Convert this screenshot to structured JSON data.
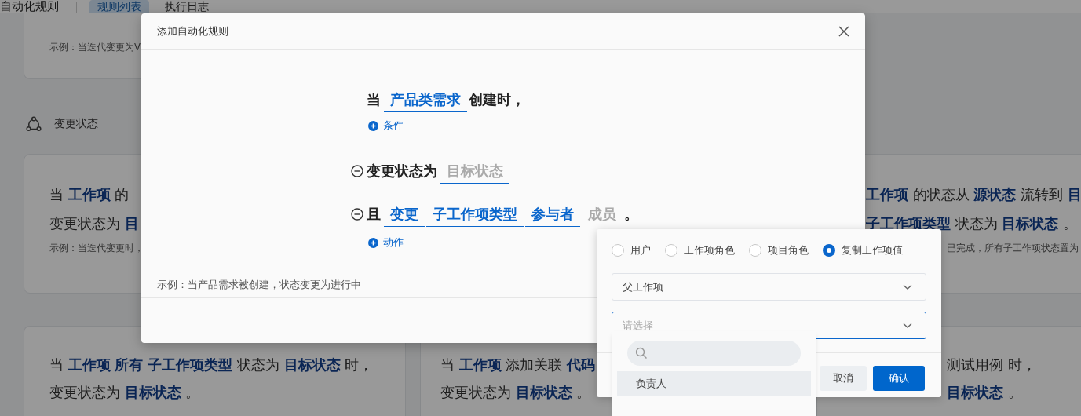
{
  "page": {
    "title": "自动化规则",
    "tabs": [
      {
        "label": "规则列表",
        "selected": true
      },
      {
        "label": "执行日志",
        "selected": false
      }
    ],
    "section": {
      "title": "变更状态"
    },
    "cards": [
      {
        "example": "示例：当迭代变更为V"
      },
      {
        "lines": [
          "当 **工作项** 的",
          "变更状态为 **目**"
        ],
        "example": "示例：当迭代变更时，"
      },
      {
        "lines": [
          "**工作项** 的状态从 **源状态** 流转到 **目**",
          "**子工作项类型** 状态为 **目标状态** 。"
        ],
        "example": "已完成，所有子工作项状态置为"
      },
      {
        "lines": [
          "当 **工作项** **所有** **子工作项类型** 状态为 **目标状态** 时，",
          "变更状态为 **目标状态** 。"
        ]
      },
      {
        "lines": [
          "当 **工作项** 添加关联 **代码**",
          "变更状态为 **目标状态** 。"
        ]
      },
      {
        "lines": [
          "测试用例 时，",
          "**目标状态** 。"
        ]
      }
    ]
  },
  "modal": {
    "title": "添加自动化规则",
    "trigger": [
      {
        "text": "当",
        "kind": "text"
      },
      {
        "text": "产品类需求",
        "kind": "value"
      },
      {
        "text": "创建时，",
        "kind": "text"
      }
    ],
    "add_condition": "条件",
    "actions": [
      [
        {
          "text": "变更状态为",
          "kind": "text"
        },
        {
          "text": "目标状态",
          "kind": "placeholder"
        }
      ],
      [
        {
          "text": "且",
          "kind": "text"
        },
        {
          "text": "变更",
          "kind": "value"
        },
        {
          "text": "子工作项类型",
          "kind": "value"
        },
        {
          "text": "参与者",
          "kind": "value"
        },
        {
          "text": "成员",
          "kind": "unset"
        },
        {
          "text": "。",
          "kind": "text"
        }
      ]
    ],
    "add_action": "动作",
    "example": "示例：当产品需求被创建，状态变更为进行中"
  },
  "popover": {
    "options": [
      {
        "label": "用户",
        "selected": false
      },
      {
        "label": "工作项角色",
        "selected": false
      },
      {
        "label": "项目角色",
        "selected": false
      },
      {
        "label": "复制工作项值",
        "selected": true
      }
    ],
    "source_select": {
      "value": "父工作项"
    },
    "field_select": {
      "placeholder": "请选择",
      "focused": true
    },
    "buttons": [
      {
        "label": "取消",
        "kind": "secondary"
      },
      {
        "label": "确认",
        "kind": "primary"
      }
    ]
  },
  "dropdown": {
    "options": [
      {
        "label": "负责人",
        "selected": true
      }
    ]
  }
}
